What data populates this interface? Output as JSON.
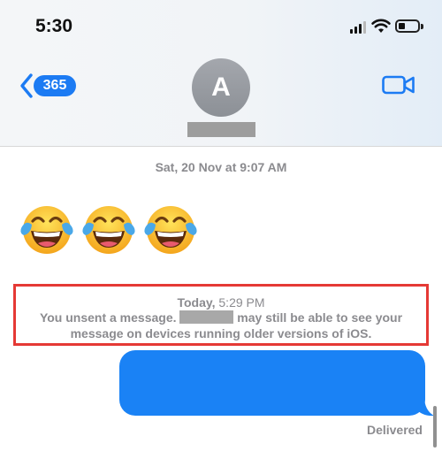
{
  "status_bar": {
    "time": "5:30",
    "icons": [
      "cellular-signal-icon",
      "wifi-icon",
      "battery-icon"
    ]
  },
  "header": {
    "back_count": "365",
    "avatar_initial": "A",
    "contact_name": "",
    "icons": [
      "chevron-left-icon",
      "video-camera-icon"
    ],
    "accent_color": "#1c7bf3"
  },
  "conversation": {
    "date_stamp": "Sat, 20 Nov at 9:07 AM",
    "emoji_message": [
      "😂",
      "😂",
      "😂"
    ],
    "unsent_notice": {
      "time_day": "Today,",
      "time_clock": " 5:29 PM",
      "line1_before": "You unsent a message.",
      "line1_after": "may still be able to see your",
      "line2": "message on devices running older versions of iOS.",
      "highlight_color": "#e53935"
    },
    "sent_bubble_color": "#1a82f5",
    "delivery_status": "Delivered"
  }
}
